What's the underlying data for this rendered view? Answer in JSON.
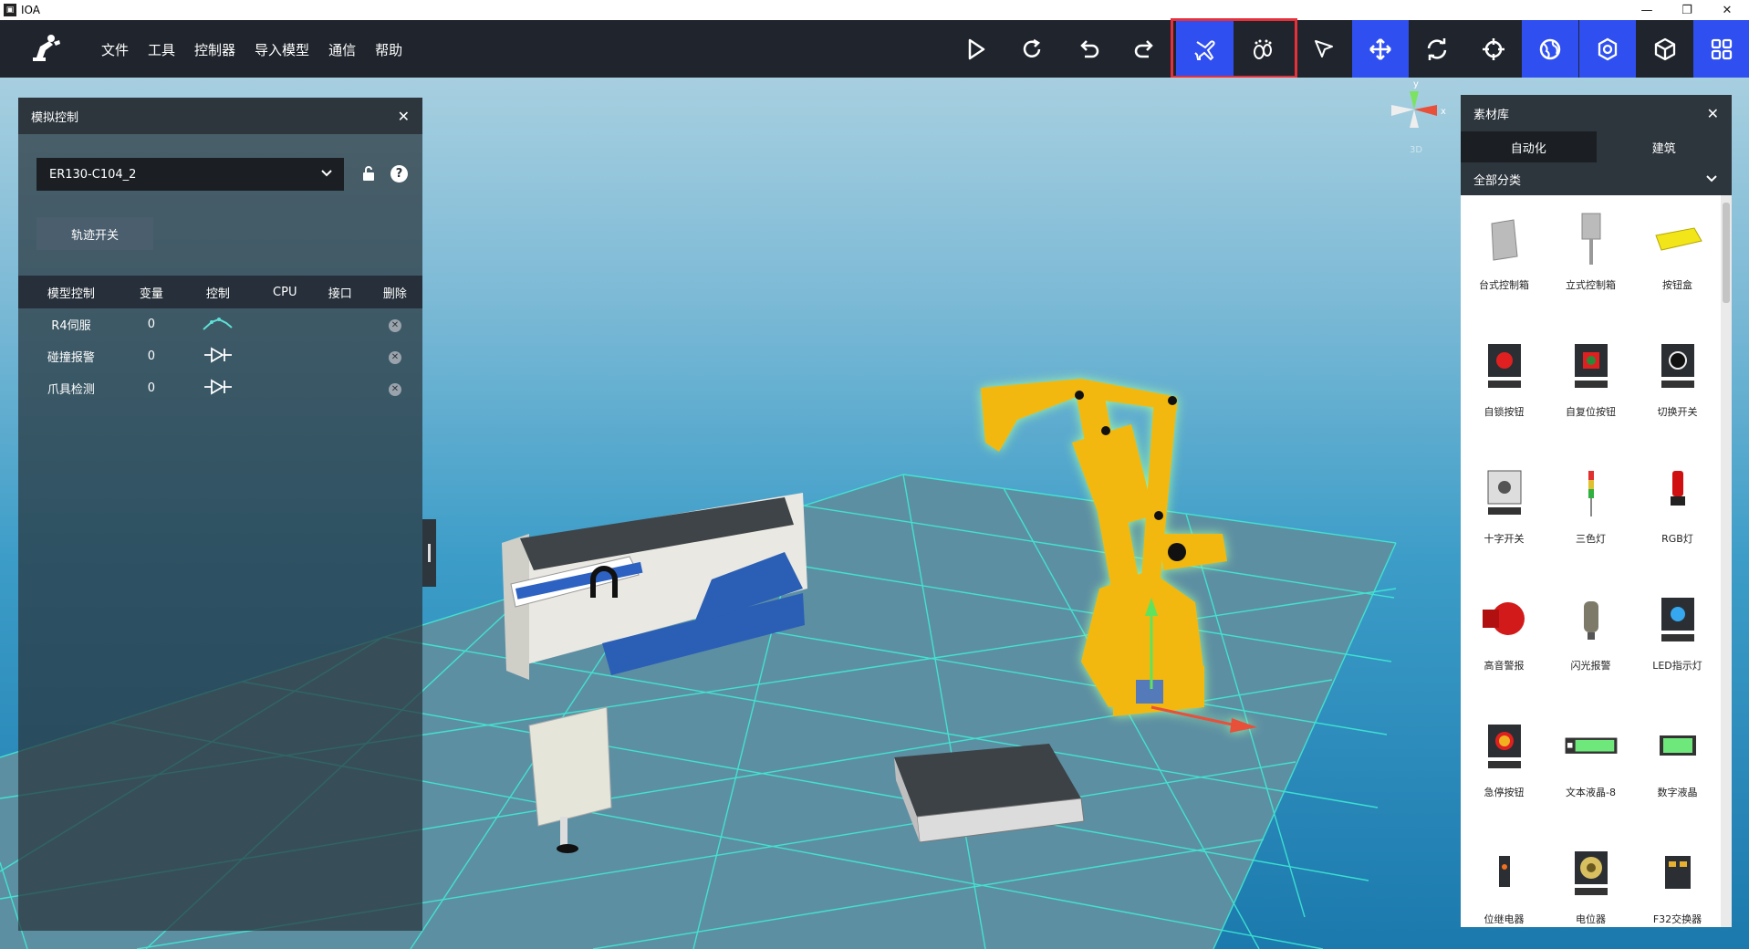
{
  "window": {
    "title": "IOA"
  },
  "menu": [
    "文件",
    "工具",
    "控制器",
    "导入模型",
    "通信",
    "帮助"
  ],
  "toolbar_icons": [
    "play-icon",
    "refresh-icon",
    "undo-icon",
    "redo-icon",
    "fly-mode-icon",
    "walk-mode-icon",
    "select-cursor-icon",
    "move-icon",
    "rotate-icon",
    "target-icon",
    "globe-icon",
    "settings-icon",
    "cube-icon",
    "grid-apps-icon"
  ],
  "sim_panel": {
    "title": "模拟控制",
    "selected_model": "ER130-C104_2",
    "track_button": "轨迹开关",
    "columns": [
      "模型控制",
      "变量",
      "控制",
      "CPU",
      "接口",
      "删除"
    ],
    "rows": [
      {
        "name": "R4伺服",
        "var": "0",
        "control": "robot-arm-icon"
      },
      {
        "name": "碰撞报警",
        "var": "0",
        "control": "diode-icon"
      },
      {
        "name": "爪具检测",
        "var": "0",
        "control": "diode-icon"
      }
    ]
  },
  "library_panel": {
    "title": "素材库",
    "tabs": [
      "自动化",
      "建筑"
    ],
    "category": "全部分类",
    "items": [
      "台式控制箱",
      "立式控制箱",
      "按钮盒",
      "自锁按钮",
      "自复位按钮",
      "切换开关",
      "十字开关",
      "三色灯",
      "RGB灯",
      "高音警报",
      "闪光报警",
      "LED指示灯",
      "急停按钮",
      "文本液晶-8",
      "数字液晶",
      "位继电器",
      "电位器",
      "F32交换器"
    ]
  },
  "axis_gizmo": {
    "x": "x",
    "y": "y",
    "label": "3D"
  },
  "colors": {
    "accent": "#2f4ff0",
    "toolbar": "#20252d",
    "highlight": "#e8303a",
    "robot": "#f2b80f"
  }
}
